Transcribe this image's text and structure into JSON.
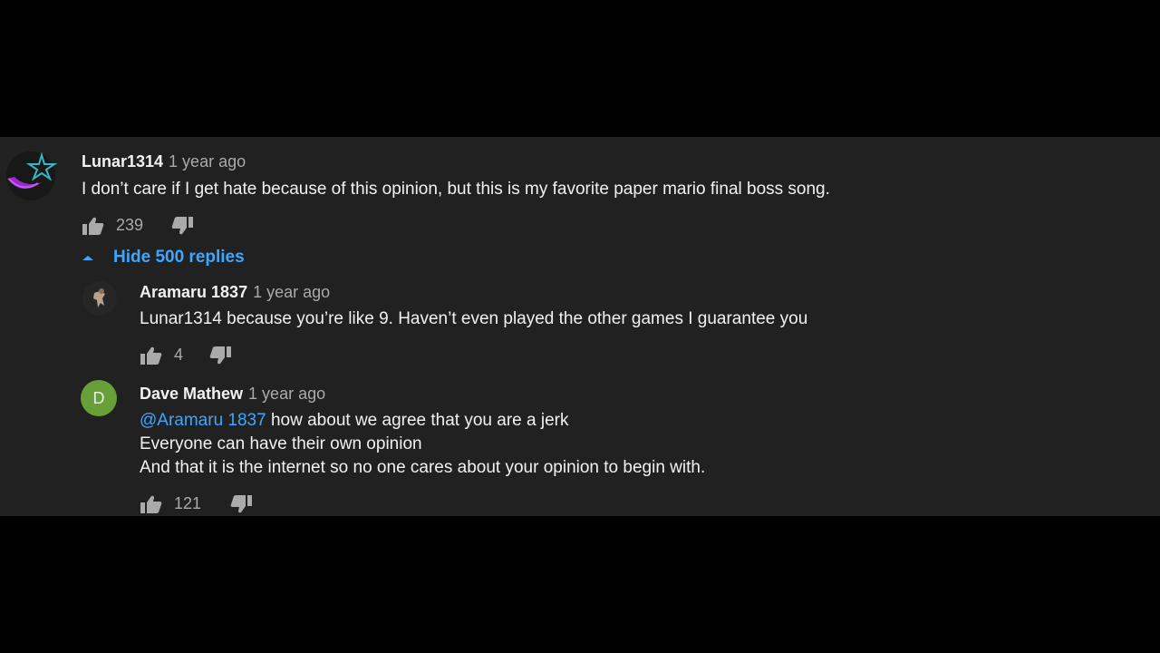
{
  "comments": [
    {
      "author": "Lunar1314",
      "time": "1 year ago",
      "text": "I don’t care if I get hate because of this opinion, but this is my favorite paper mario final boss song.",
      "likes": "239",
      "avatar_icon": "purple-moon-star-avatar"
    }
  ],
  "replies_toggle": {
    "label": "Hide 500 replies",
    "icon": "chevron-up-icon"
  },
  "replies": [
    {
      "author": "Aramaru 1837",
      "time": "1 year ago",
      "text": "Lunar1314  because you’re like 9. Haven’t even played the other games I guarantee you",
      "likes": "4",
      "avatar_icon": "small-figure-avatar"
    },
    {
      "author": "Dave Mathew",
      "time": "1 year ago",
      "avatar_letter": "D",
      "mention": "@Aramaru 1837",
      "text_line1": " how about we agree that you are a jerk",
      "text_line2": "Everyone can have their own opinion",
      "text_line3": "And that it is the internet so no one cares about your opinion to begin with.",
      "likes": "121"
    }
  ],
  "colors": {
    "background": "#000000",
    "panel": "#212121",
    "text_primary": "#f1f1f1",
    "text_secondary": "#aaaaaa",
    "accent_blue": "#3ea6ff",
    "avatar_green": "#689f38"
  }
}
